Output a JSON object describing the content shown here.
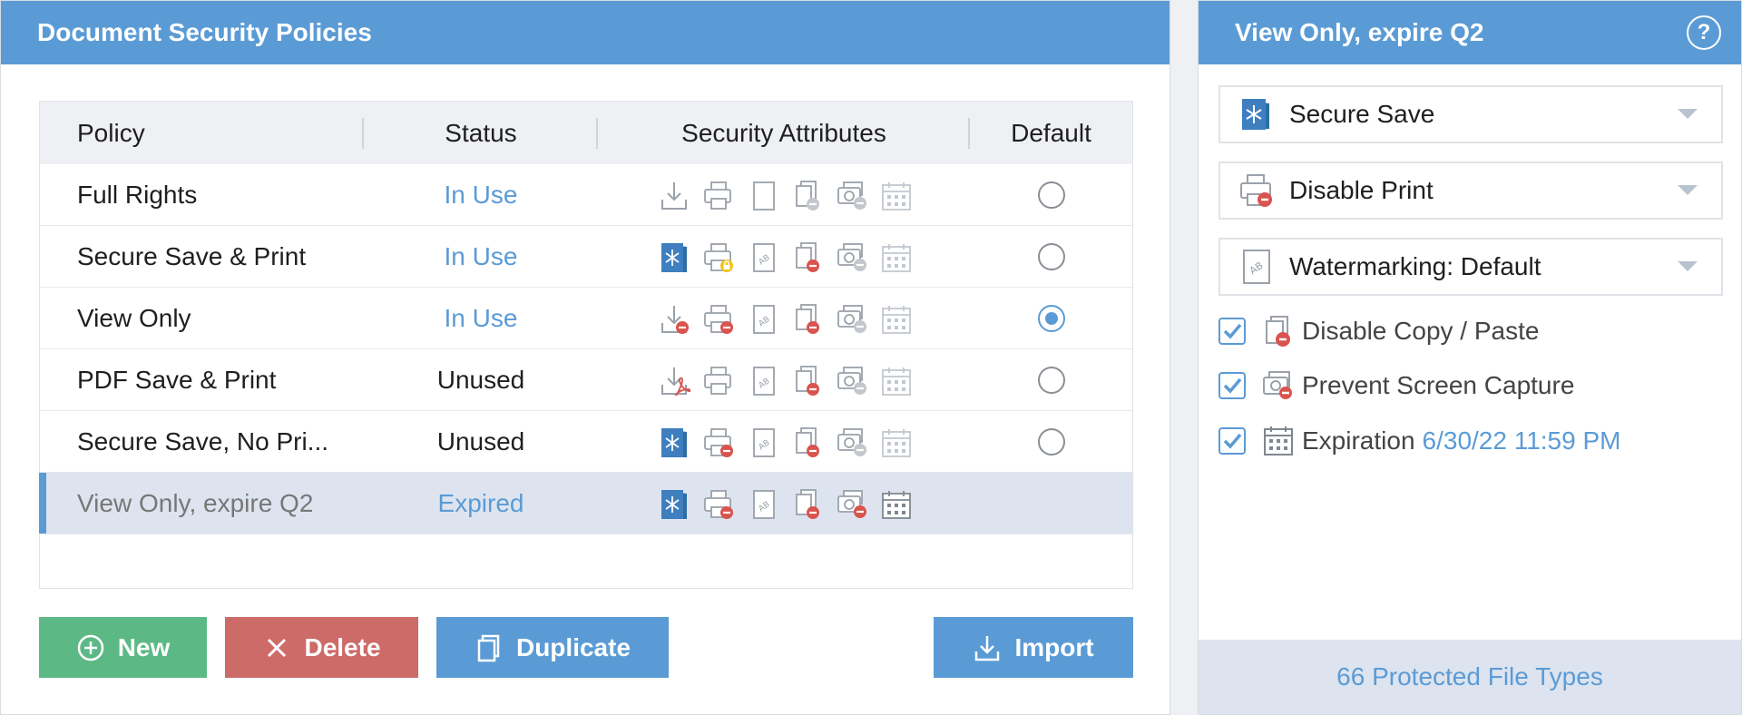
{
  "left_panel": {
    "title": "Document Security Policies",
    "columns": {
      "policy": "Policy",
      "status": "Status",
      "attributes": "Security Attributes",
      "default": "Default"
    },
    "rows": [
      {
        "policy": "Full Rights",
        "status": "In Use",
        "status_link": true,
        "default": false,
        "icons": [
          "download-icon",
          "print-icon",
          "blank-page-icon",
          "copy-disabled-gray-icon",
          "capture-disabled-gray-icon",
          "calendar-gray-icon"
        ]
      },
      {
        "policy": "Secure Save & Print",
        "status": "In Use",
        "status_link": true,
        "default": false,
        "icons": [
          "secure-save-icon",
          "print-lock-icon",
          "watermark-icon",
          "copy-disabled-red-icon",
          "capture-disabled-gray-icon",
          "calendar-gray-icon"
        ]
      },
      {
        "policy": "View Only",
        "status": "In Use",
        "status_link": true,
        "default": true,
        "icons": [
          "download-disabled-icon",
          "print-disabled-icon",
          "watermark-icon",
          "copy-disabled-red-icon",
          "capture-disabled-gray-icon",
          "calendar-gray-icon"
        ]
      },
      {
        "policy": "PDF Save & Print",
        "status": "Unused",
        "status_link": false,
        "default": false,
        "icons": [
          "pdf-download-icon",
          "print-icon",
          "watermark-icon",
          "copy-disabled-red-icon",
          "capture-disabled-gray-icon",
          "calendar-gray-icon"
        ]
      },
      {
        "policy": "Secure Save, No Pri...",
        "status": "Unused",
        "status_link": false,
        "default": false,
        "icons": [
          "secure-save-icon",
          "print-disabled-icon",
          "watermark-icon",
          "copy-disabled-red-icon",
          "capture-disabled-gray-icon",
          "calendar-gray-icon"
        ]
      },
      {
        "policy": "View Only, expire Q2",
        "status": "Expired",
        "status_link": true,
        "default": null,
        "selected": true,
        "icons": [
          "secure-save-icon",
          "print-disabled-icon",
          "watermark-icon",
          "copy-disabled-red-icon",
          "capture-disabled-red-icon",
          "calendar-dark-icon"
        ]
      }
    ],
    "buttons": {
      "new": "New",
      "delete": "Delete",
      "duplicate": "Duplicate",
      "import": "Import"
    }
  },
  "right_panel": {
    "title": "View Only, expire Q2",
    "help": "?",
    "dropdowns": [
      {
        "label": "Secure Save",
        "icon": "secure-save-icon"
      },
      {
        "label": "Disable Print",
        "icon": "print-disabled-icon"
      },
      {
        "label": "Watermarking: Default",
        "icon": "watermark-icon"
      }
    ],
    "checks": [
      {
        "label": "Disable Copy / Paste",
        "checked": true,
        "icon": "copy-disabled-icon"
      },
      {
        "label": "Prevent Screen Capture",
        "checked": true,
        "icon": "capture-disabled-icon"
      },
      {
        "label": "Expiration",
        "checked": true,
        "icon": "calendar-icon",
        "value": "6/30/22 11:59 PM"
      }
    ],
    "footer": "66 Protected File Types"
  },
  "colors": {
    "accent": "#5b9bd5",
    "new": "#5cb985",
    "delete": "#cc6b68",
    "disabled_red": "#d9534f",
    "lock_yellow": "#f0c419"
  }
}
